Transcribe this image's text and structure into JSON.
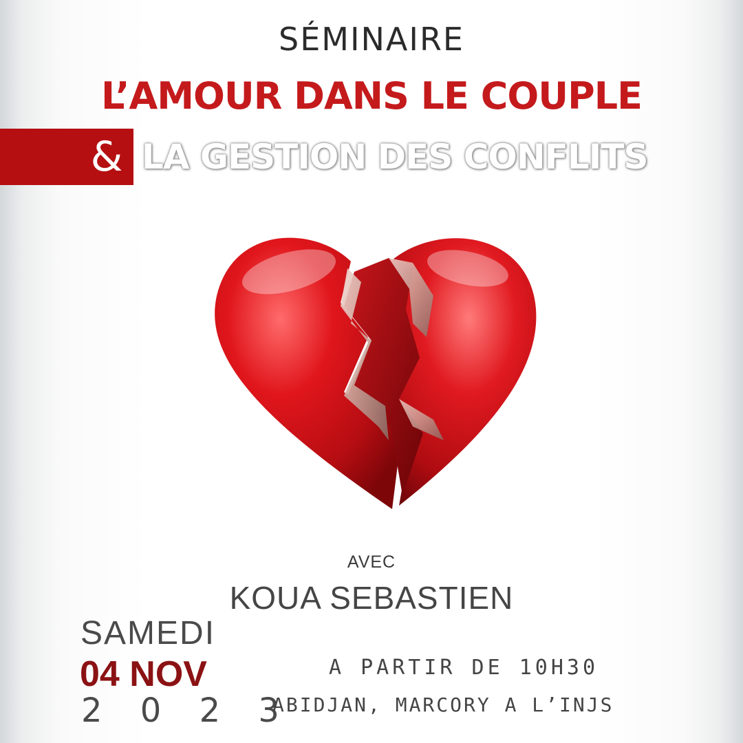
{
  "event": {
    "kicker": "SÉMINAIRE",
    "title_line1": "L’AMOUR DANS LE COUPLE",
    "ampersand": "&",
    "title_line2": "LA GESTION DES CONFLITS"
  },
  "speaker": {
    "intro": "AVEC",
    "name": "KOUA SEBASTIEN"
  },
  "schedule": {
    "day": "SAMEDI",
    "date": "04 NOV",
    "year": "2 0 2 3",
    "time": "A PARTIR DE 10H30",
    "location": "ABIDJAN, MARCORY A L’INJS"
  },
  "colors": {
    "accent_red": "#c41a1c",
    "band_red": "#b50f12",
    "date_red": "#8b1214"
  },
  "icons": {
    "hero_image": "broken-heart-icon"
  }
}
